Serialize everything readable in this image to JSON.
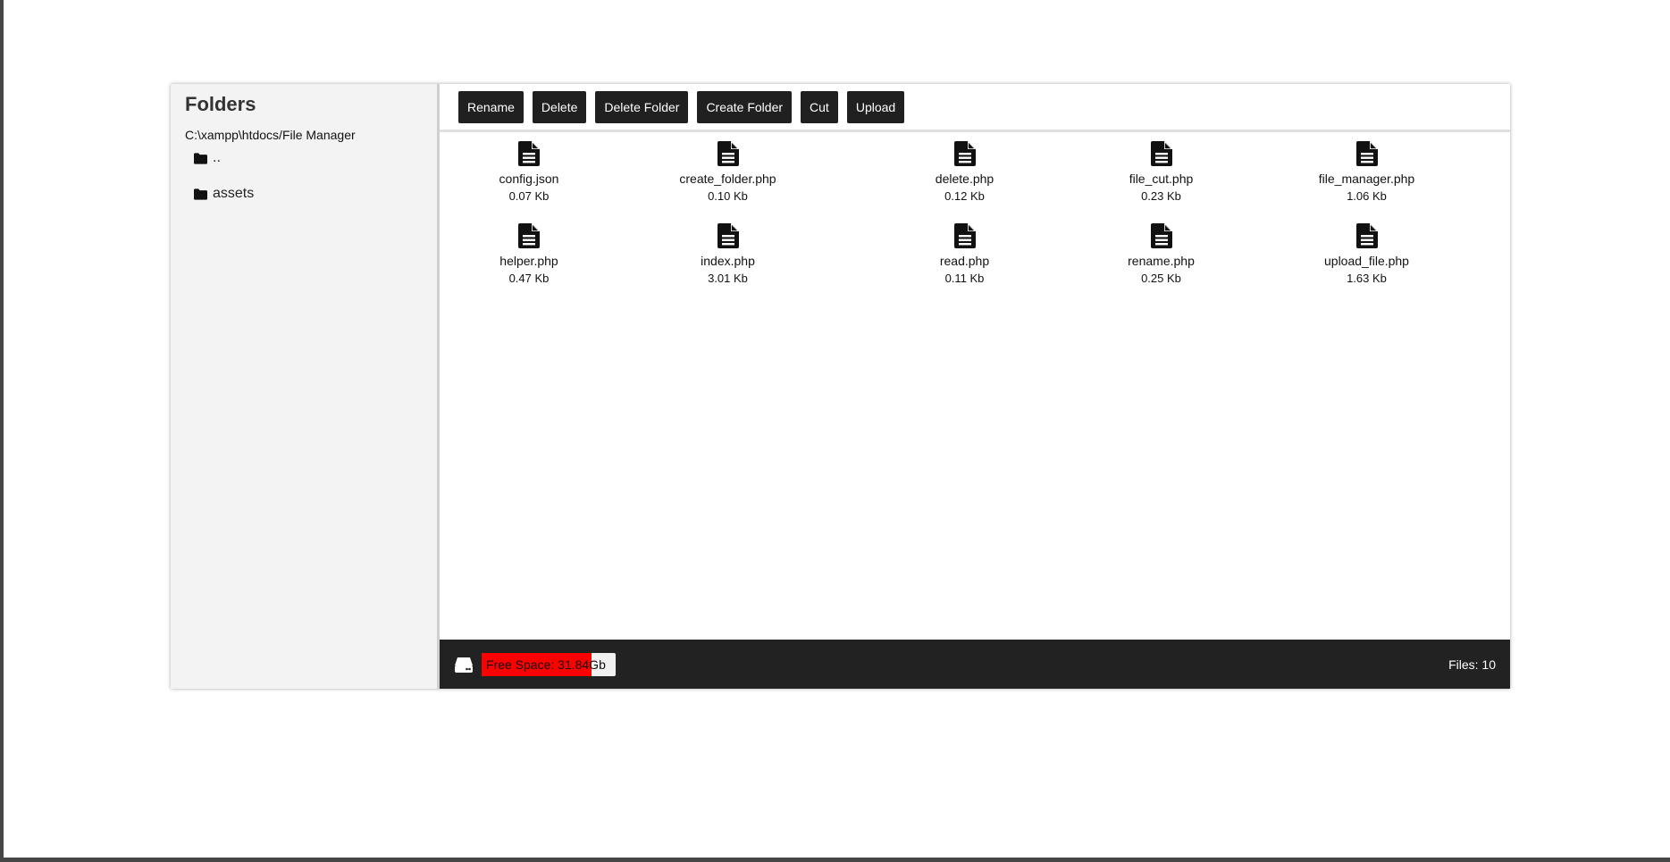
{
  "sidebar": {
    "title": "Folders",
    "path": "C:\\xampp\\htdocs/File Manager",
    "folders": [
      {
        "name": ".."
      },
      {
        "name": "assets"
      }
    ]
  },
  "toolbar": {
    "buttons": [
      "Rename",
      "Delete",
      "Delete Folder",
      "Create Folder",
      "Cut",
      "Upload"
    ]
  },
  "files": [
    {
      "name": "config.json",
      "size": "0.07 Kb",
      "icon": "file-icon"
    },
    {
      "name": "create_folder.php",
      "size": "0.10 Kb",
      "icon": "file-icon"
    },
    {
      "name": "delete.php",
      "size": "0.12 Kb",
      "icon": "file-icon"
    },
    {
      "name": "file_cut.php",
      "size": "0.23 Kb",
      "icon": "file-icon"
    },
    {
      "name": "file_manager.php",
      "size": "1.06 Kb",
      "icon": "file-icon"
    },
    {
      "name": "helper.php",
      "size": "0.47 Kb",
      "icon": "file-icon"
    },
    {
      "name": "index.php",
      "size": "3.01 Kb",
      "icon": "file-icon"
    },
    {
      "name": "read.php",
      "size": "0.11 Kb",
      "icon": "file-icon"
    },
    {
      "name": "rename.php",
      "size": "0.25 Kb",
      "icon": "file-icon"
    },
    {
      "name": "upload_file.php",
      "size": "1.63 Kb",
      "icon": "file-icon"
    }
  ],
  "status": {
    "free_space_label": "Free Space: 31.84Gb",
    "used_fraction": 0.82,
    "files_count_label": "Files: 10",
    "drive_icon": "hdd-icon",
    "colors": {
      "bar": "#222222",
      "space_fill": "#ff0000",
      "space_track": "#f0f0f0"
    }
  }
}
